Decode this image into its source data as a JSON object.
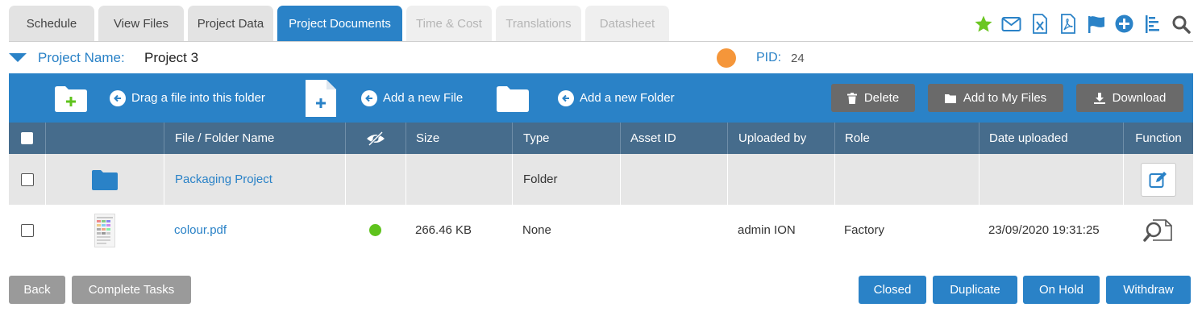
{
  "tabs": [
    {
      "label": "Schedule",
      "state": "normal"
    },
    {
      "label": "View Files",
      "state": "normal"
    },
    {
      "label": "Project Data",
      "state": "normal"
    },
    {
      "label": "Project Documents",
      "state": "active"
    },
    {
      "label": "Time & Cost",
      "state": "disabled"
    },
    {
      "label": "Translations",
      "state": "disabled"
    },
    {
      "label": "Datasheet",
      "state": "disabled"
    }
  ],
  "top_icons": [
    "star-icon",
    "mail-icon",
    "excel-icon",
    "pdf-icon",
    "flag-icon",
    "plus-circle-icon",
    "list-icon",
    "search-icon"
  ],
  "project": {
    "name_label": "Project Name:",
    "name_value": "Project 3",
    "status_color": "#f5963a",
    "pid_label": "PID:",
    "pid_value": "24"
  },
  "toolbar": {
    "drag_label": "Drag a file into this folder",
    "add_file_label": "Add a new File",
    "add_folder_label": "Add a new Folder",
    "delete_label": "Delete",
    "add_my_files_label": "Add to My Files",
    "download_label": "Download"
  },
  "table": {
    "headers": {
      "name": "File / Folder Name",
      "size": "Size",
      "type": "Type",
      "asset_id": "Asset ID",
      "uploaded_by": "Uploaded by",
      "role": "Role",
      "date": "Date uploaded",
      "function": "Function"
    },
    "rows": [
      {
        "name": "Packaging Project",
        "visible": "",
        "size": "",
        "type": "Folder",
        "asset_id": "",
        "uploaded_by": "",
        "role": "",
        "date": "",
        "icon": "folder-icon"
      },
      {
        "name": "colour.pdf",
        "visible": "green",
        "size": "266.46 KB",
        "type": "None",
        "asset_id": "",
        "uploaded_by": "admin ION",
        "role": "Factory",
        "date": "23/09/2020 19:31:25",
        "icon": "file-thumbnail"
      }
    ]
  },
  "footer": {
    "back_label": "Back",
    "complete_label": "Complete Tasks",
    "closed_label": "Closed",
    "duplicate_label": "Duplicate",
    "onhold_label": "On Hold",
    "withdraw_label": "Withdraw"
  },
  "colors": {
    "accent": "#2a82c7",
    "header": "#466c8c",
    "star": "#6cc623",
    "status_dot": "#f5963a",
    "visibility_dot": "#5fc31d"
  }
}
